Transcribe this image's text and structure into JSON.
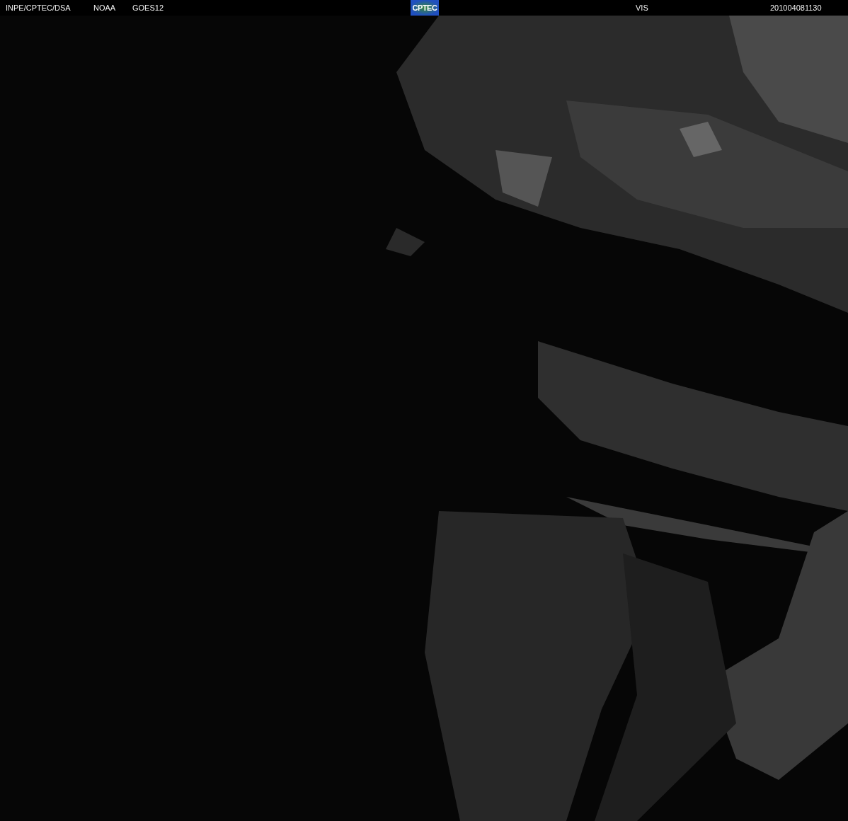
{
  "header": {
    "source": "INPE/CPTEC/DSA",
    "agency": "NOAA",
    "satellite": "GOES12",
    "logo": "CPTEC",
    "channel": "VIS",
    "timestamp": "201004081130"
  }
}
